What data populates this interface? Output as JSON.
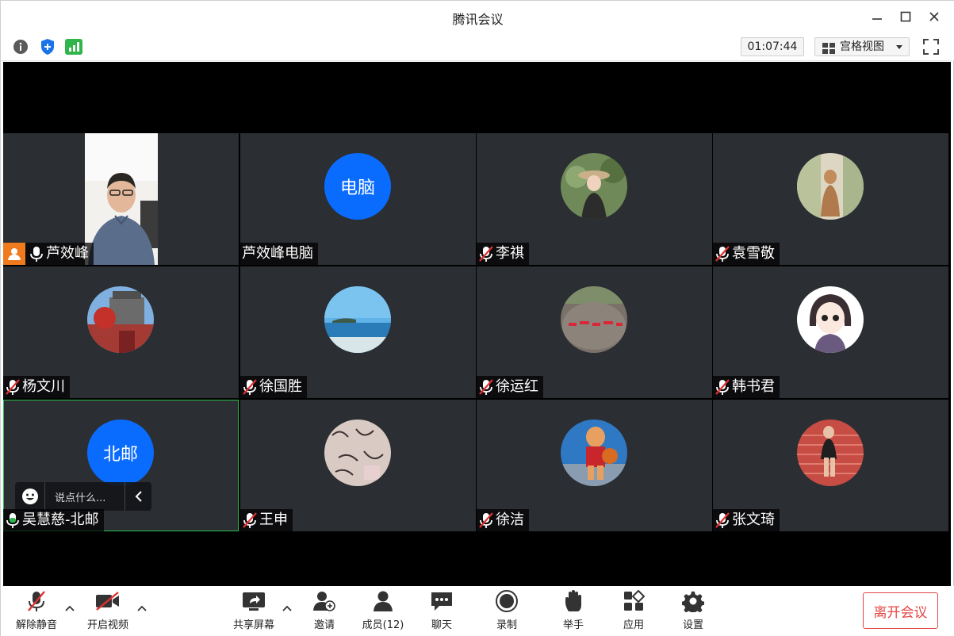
{
  "window": {
    "title": "腾讯会议"
  },
  "infobar": {
    "timer": "01:07:44",
    "view_mode": "宫格视图"
  },
  "tiles": [
    {
      "name": "芦效峰",
      "mic": "on",
      "host": true,
      "kind": "video"
    },
    {
      "name": "芦效峰电脑",
      "mic": "none",
      "kind": "text",
      "avatar_text": "电脑"
    },
    {
      "name": "李祺",
      "mic": "muted",
      "kind": "photo",
      "photo": "girl-in-hat"
    },
    {
      "name": "袁雪敬",
      "mic": "muted",
      "kind": "photo",
      "photo": "painting"
    },
    {
      "name": "杨文川",
      "mic": "muted",
      "kind": "photo",
      "photo": "gate-tower"
    },
    {
      "name": "徐国胜",
      "mic": "muted",
      "kind": "photo",
      "photo": "sea"
    },
    {
      "name": "徐运红",
      "mic": "muted",
      "kind": "photo",
      "photo": "stone-inscription"
    },
    {
      "name": "韩书君",
      "mic": "muted",
      "kind": "photo",
      "photo": "cartoon-girl"
    },
    {
      "name": "吴慧慈-北邮",
      "mic": "on",
      "kind": "text",
      "avatar_text": "北邮",
      "active": true
    },
    {
      "name": "王申",
      "mic": "muted",
      "kind": "photo",
      "photo": "sketch"
    },
    {
      "name": "徐洁",
      "mic": "muted",
      "kind": "photo",
      "photo": "basketball-figure"
    },
    {
      "name": "张文琦",
      "mic": "muted",
      "kind": "photo",
      "photo": "girl-on-steps"
    }
  ],
  "chat_bubble": {
    "placeholder": "说点什么..."
  },
  "toolbar": {
    "unmute": "解除静音",
    "start_video": "开启视频",
    "share_screen": "共享屏幕",
    "invite": "邀请",
    "members": "成员(12)",
    "chat": "聊天",
    "record": "录制",
    "raise_hand": "举手",
    "apps": "应用",
    "settings": "设置",
    "leave": "离开会议"
  },
  "colors": {
    "accent_blue": "#0a6cff",
    "leave_red": "#e54545",
    "host_orange": "#f07a1e",
    "active_green": "#27c14b",
    "tile_bg": "#2b2e32"
  }
}
